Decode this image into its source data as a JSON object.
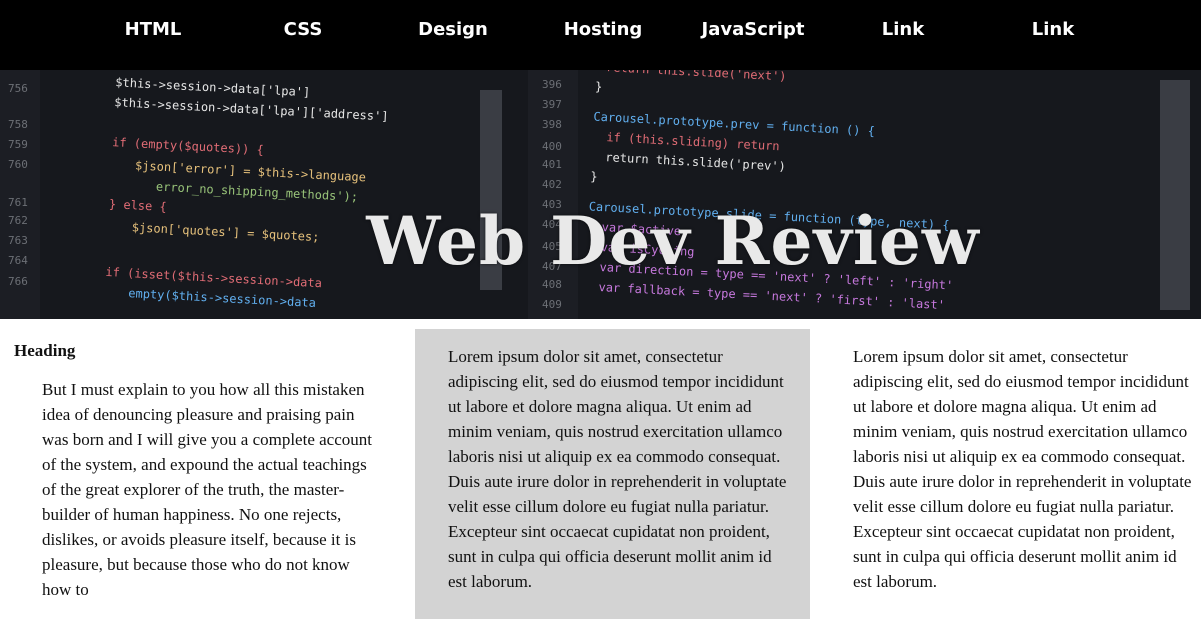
{
  "nav": {
    "items": [
      {
        "label": "HTML"
      },
      {
        "label": "CSS"
      },
      {
        "label": "Design"
      },
      {
        "label": "Hosting"
      },
      {
        "label": "JavaScript"
      },
      {
        "label": "Link"
      },
      {
        "label": "Link"
      }
    ]
  },
  "hero": {
    "title": "Web Dev Review"
  },
  "columns": {
    "col1": {
      "heading": "Heading",
      "text": "But I must explain to you how all this mistaken idea of denouncing pleasure and praising pain was born and I will give you a complete account of the system, and expound the actual teachings of the great explorer of the truth, the master-builder of human happiness. No one rejects, dislikes, or avoids pleasure itself, because it is pleasure, but because those who do not know how to"
    },
    "col2": {
      "text": "Lorem ipsum dolor sit amet, consectetur adipiscing elit, sed do eiusmod tempor incididunt ut labore et dolore magna aliqua. Ut enim ad minim veniam, quis nostrud exercitation ullamco laboris nisi ut aliquip ex ea commodo consequat. Duis aute irure dolor in reprehenderit in voluptate velit esse cillum dolore eu fugiat nulla pariatur. Excepteur sint occaecat cupidatat non proident, sunt in culpa qui officia deserunt mollit anim id est laborum."
    },
    "col3": {
      "text": "Lorem ipsum dolor sit amet, consectetur adipiscing elit, sed do eiusmod tempor incididunt ut labore et dolore magna aliqua. Ut enim ad minim veniam, quis nostrud exercitation ullamco laboris nisi ut aliquip ex ea commodo consequat. Duis aute irure dolor in reprehenderit in voluptate velit esse cillum dolore eu fugiat nulla pariatur. Excepteur sint occaecat cupidatat non proident, sunt in culpa qui officia deserunt mollit anim id est laborum."
    }
  },
  "colors": {
    "nav_bg": "#000000",
    "nav_text": "#ffffff",
    "highlight_column_bg": "#d3d3d3",
    "hero_bg": "#15171c"
  }
}
